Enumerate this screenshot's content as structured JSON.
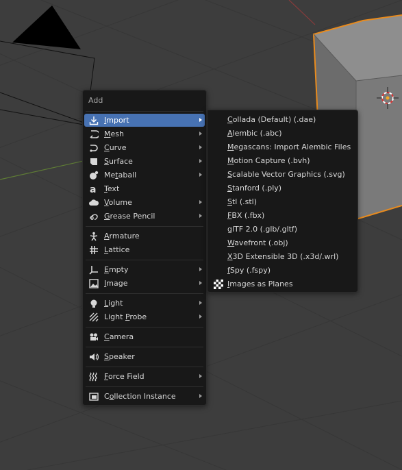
{
  "add_menu": {
    "title": "Add",
    "items": [
      {
        "label": "Import",
        "mnemonic": "I",
        "icon": "import-icon",
        "submenu": true,
        "active": true
      },
      {
        "label": "Mesh",
        "mnemonic": "M",
        "icon": "mesh-icon",
        "submenu": true
      },
      {
        "label": "Curve",
        "mnemonic": "C",
        "icon": "curve-icon",
        "submenu": true
      },
      {
        "label": "Surface",
        "mnemonic": "S",
        "icon": "surface-icon",
        "submenu": true
      },
      {
        "label": "Metaball",
        "mnemonic": "t",
        "icon": "metaball-icon",
        "submenu": true
      },
      {
        "label": "Text",
        "mnemonic": "T",
        "icon": "text-icon",
        "submenu": false
      },
      {
        "label": "Volume",
        "mnemonic": "V",
        "icon": "volume-icon",
        "submenu": true
      },
      {
        "label": "Grease Pencil",
        "mnemonic": "G",
        "icon": "grease-pencil-icon",
        "submenu": true
      },
      {
        "label": "Armature",
        "mnemonic": "A",
        "icon": "armature-icon",
        "submenu": false
      },
      {
        "label": "Lattice",
        "mnemonic": "L",
        "icon": "lattice-icon",
        "submenu": false
      },
      {
        "label": "Empty",
        "mnemonic": "E",
        "icon": "empty-icon",
        "submenu": true
      },
      {
        "label": "Image",
        "mnemonic": "I",
        "icon": "image-icon",
        "submenu": true
      },
      {
        "label": "Light",
        "mnemonic": "L",
        "icon": "light-icon",
        "submenu": true
      },
      {
        "label": "Light Probe",
        "mnemonic": "P",
        "icon": "light-probe-icon",
        "submenu": true
      },
      {
        "label": "Camera",
        "mnemonic": "C",
        "icon": "camera-icon",
        "submenu": false
      },
      {
        "label": "Speaker",
        "mnemonic": "S",
        "icon": "speaker-icon",
        "submenu": false
      },
      {
        "label": "Force Field",
        "mnemonic": "F",
        "icon": "force-field-icon",
        "submenu": true
      },
      {
        "label": "Collection Instance",
        "mnemonic": "o",
        "icon": "collection-instance-icon",
        "submenu": true
      }
    ]
  },
  "import_submenu": {
    "items": [
      {
        "label": "Collada (Default) (.dae)",
        "mnemonic": "C"
      },
      {
        "label": "Alembic (.abc)",
        "mnemonic": "A"
      },
      {
        "label": "Megascans: Import Alembic Files",
        "mnemonic": "M"
      },
      {
        "label": "Motion Capture (.bvh)",
        "mnemonic": "M"
      },
      {
        "label": "Scalable Vector Graphics (.svg)",
        "mnemonic": "S"
      },
      {
        "label": "Stanford (.ply)",
        "mnemonic": "S"
      },
      {
        "label": "Stl (.stl)",
        "mnemonic": "S"
      },
      {
        "label": "FBX (.fbx)",
        "mnemonic": "F"
      },
      {
        "label": "glTF 2.0 (.glb/.gltf)",
        "mnemonic": "g"
      },
      {
        "label": "Wavefront (.obj)",
        "mnemonic": "W"
      },
      {
        "label": "X3D Extensible 3D (.x3d/.wrl)",
        "mnemonic": "X"
      },
      {
        "label": "fSpy (.fspy)",
        "mnemonic": "f"
      },
      {
        "label": "Images as Planes",
        "mnemonic": "I",
        "icon": "checkerboard-icon"
      }
    ]
  },
  "colors": {
    "viewport_bg": "#3d3d3d",
    "grid_line": "#363636",
    "x_axis": "#8a3b3b",
    "y_axis": "#5f7d35",
    "menu_bg": "#181818",
    "highlight": "#4772b3",
    "selection_outline": "#e88b1e"
  }
}
